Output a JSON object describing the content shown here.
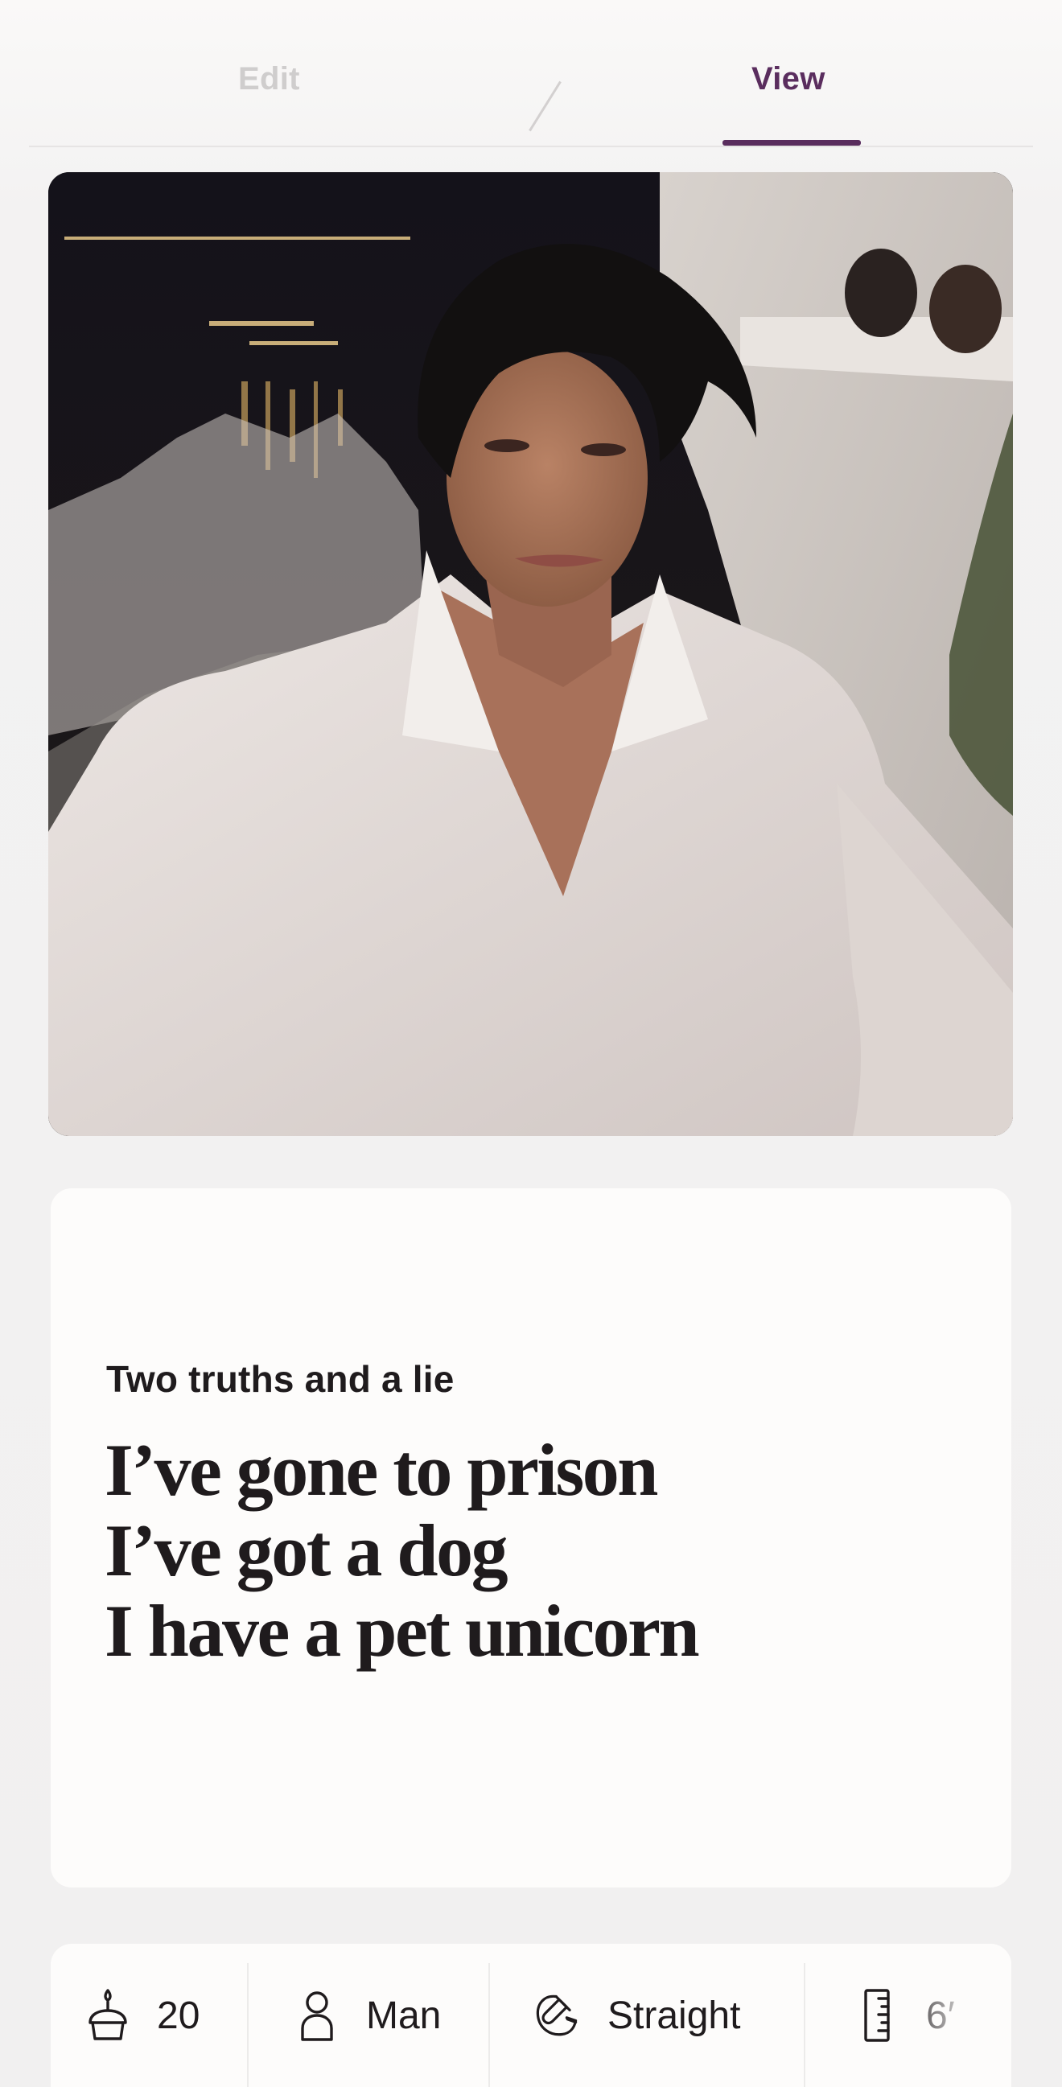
{
  "tabs": {
    "edit": "Edit",
    "view": "View",
    "active": "View"
  },
  "photo": {
    "alt": "Profile photo"
  },
  "prompt": {
    "title": "Two truths and a lie",
    "answer_lines": [
      "I’ve gone to prison",
      "I’ve got a dog",
      "I have a pet unicorn"
    ]
  },
  "info": {
    "items": [
      {
        "icon": "cake-icon",
        "label": "20"
      },
      {
        "icon": "person-icon",
        "label": "Man"
      },
      {
        "icon": "magnet-icon",
        "label": "Straight"
      },
      {
        "icon": "ruler-icon",
        "label": "6′"
      }
    ]
  },
  "colors": {
    "accent": "#5a2d5e",
    "inactive_tab": "#cfcdcd",
    "card": "#fdfcfb",
    "background": "#f2f1f1",
    "text": "#1f1b1d"
  }
}
